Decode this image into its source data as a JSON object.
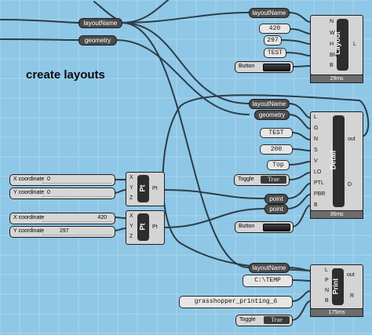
{
  "canvas": {
    "background": "#8fc7e6",
    "grid_color": "#a9d6ee"
  },
  "heading": "create layouts",
  "params": {
    "layoutName": "layoutName",
    "geometry": "geometry",
    "point": "point"
  },
  "layout": {
    "title": "Layout",
    "inputs": [
      "N",
      "W",
      "H",
      "BN",
      "B"
    ],
    "output": "L",
    "timing": "29ms",
    "values": {
      "name": "420",
      "height": "297",
      "text": "TEST"
    },
    "button": "Button"
  },
  "detail": {
    "title": "Detail",
    "inputs": [
      "L",
      "G",
      "N",
      "S",
      "V",
      "LO",
      "PTL",
      "PBR",
      "B"
    ],
    "outputs": [
      "out",
      "D"
    ],
    "timing": "36ms",
    "values": {
      "name": "TEST",
      "scale": "200",
      "view": "Top"
    },
    "toggle": {
      "label": "Toggle",
      "value": "True"
    },
    "button": "Button"
  },
  "pt_components": [
    {
      "title": "Pt",
      "inputs": [
        "X",
        "Y",
        "Z"
      ],
      "output": "Pt",
      "sliders": [
        {
          "label": "X coordinate",
          "value": "0"
        },
        {
          "label": "Y coordinate",
          "value": "0"
        }
      ]
    },
    {
      "title": "Pt",
      "inputs": [
        "X",
        "Y",
        "Z"
      ],
      "output": "Pt",
      "sliders": [
        {
          "label": "X coordinate",
          "value": "420"
        },
        {
          "label": "Y coordinate",
          "value": "297"
        }
      ]
    }
  ],
  "print": {
    "title": "Print",
    "inputs": [
      "L",
      "P",
      "N",
      "B"
    ],
    "outputs": [
      "out",
      "R"
    ],
    "timing": "175ms",
    "values": {
      "path": "C:\\TEMP",
      "filename": "grasshopper_printing_6"
    },
    "toggle": {
      "label": "Toggle",
      "value": "True"
    }
  }
}
